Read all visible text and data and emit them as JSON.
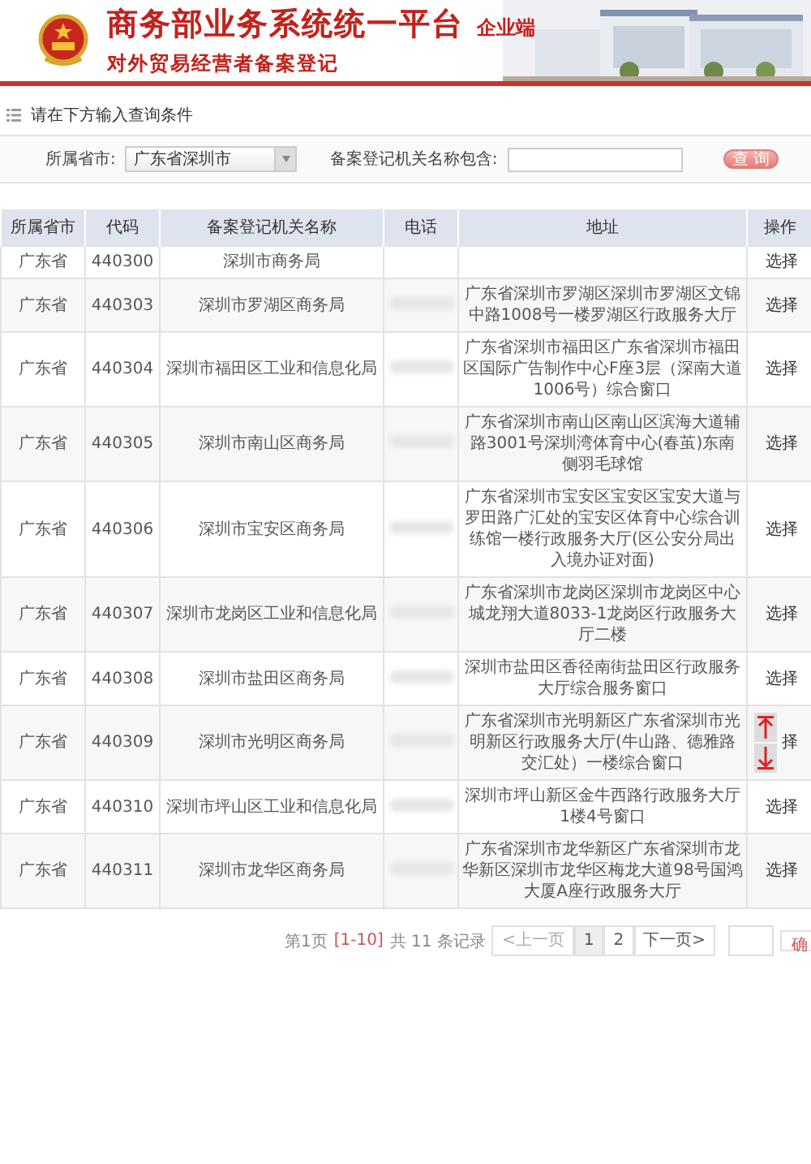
{
  "header": {
    "title": "商务部业务系统统一平台",
    "edition": "企业端",
    "subtitle": "对外贸易经营者备案登记"
  },
  "query": {
    "heading": "请在下方输入查询条件",
    "province_label": "所属省市:",
    "province_value": "广东省深圳市",
    "name_label": "备案登记机关名称包含:",
    "search_button": "查 询"
  },
  "table": {
    "columns": [
      "所属省市",
      "代码",
      "备案登记机关名称",
      "电话",
      "地址",
      "操作"
    ],
    "rows": [
      {
        "province": "广东省",
        "code": "440300",
        "name": "深圳市商务局",
        "phone_redacted": false,
        "address": "",
        "action": "选择",
        "scroll_buttons": false
      },
      {
        "province": "广东省",
        "code": "440303",
        "name": "深圳市罗湖区商务局",
        "phone_redacted": true,
        "address": "广东省深圳市罗湖区深圳市罗湖区文锦中路1008号一楼罗湖区行政服务大厅",
        "action": "选择",
        "scroll_buttons": false
      },
      {
        "province": "广东省",
        "code": "440304",
        "name": "深圳市福田区工业和信息化局",
        "phone_redacted": true,
        "address": "广东省深圳市福田区广东省深圳市福田区国际广告制作中心F座3层（深南大道1006号）综合窗口",
        "action": "选择",
        "scroll_buttons": false
      },
      {
        "province": "广东省",
        "code": "440305",
        "name": "深圳市南山区商务局",
        "phone_redacted": true,
        "address": "广东省深圳市南山区南山区滨海大道辅路3001号深圳湾体育中心(春茧)东南侧羽毛球馆",
        "action": "选择",
        "scroll_buttons": false
      },
      {
        "province": "广东省",
        "code": "440306",
        "name": "深圳市宝安区商务局",
        "phone_redacted": true,
        "address": "广东省深圳市宝安区宝安区宝安大道与罗田路广汇处的宝安区体育中心综合训练馆一楼行政服务大厅(区公安分局出入境办证对面)",
        "action": "选择",
        "scroll_buttons": false
      },
      {
        "province": "广东省",
        "code": "440307",
        "name": "深圳市龙岗区工业和信息化局",
        "phone_redacted": true,
        "address": "广东省深圳市龙岗区深圳市龙岗区中心城龙翔大道8033-1龙岗区行政服务大厅二楼",
        "action": "选择",
        "scroll_buttons": false
      },
      {
        "province": "广东省",
        "code": "440308",
        "name": "深圳市盐田区商务局",
        "phone_redacted": true,
        "address": "深圳市盐田区香径南街盐田区行政服务大厅综合服务窗口",
        "action": "选择",
        "scroll_buttons": false
      },
      {
        "province": "广东省",
        "code": "440309",
        "name": "深圳市光明区商务局",
        "phone_redacted": true,
        "address": "广东省深圳市光明新区广东省深圳市光明新区行政服务大厅(牛山路、德雅路交汇处）一楼综合窗口",
        "action": "择",
        "scroll_buttons": true
      },
      {
        "province": "广东省",
        "code": "440310",
        "name": "深圳市坪山区工业和信息化局",
        "phone_redacted": true,
        "address": "深圳市坪山新区金牛西路行政服务大厅1楼4号窗口",
        "action": "选择",
        "scroll_buttons": false
      },
      {
        "province": "广东省",
        "code": "440311",
        "name": "深圳市龙华区商务局",
        "phone_redacted": true,
        "address": "广东省深圳市龙华新区广东省深圳市龙华新区深圳市龙华区梅龙大道98号国鸿大厦A座行政服务大厅",
        "action": "选择",
        "scroll_buttons": false
      }
    ]
  },
  "pager": {
    "current": "第1页",
    "range": "[1-10]",
    "total": "共 11 条记录",
    "prev": "<上一页",
    "pages": [
      {
        "label": "1",
        "selected": true
      },
      {
        "label": "2",
        "selected": false
      }
    ],
    "next": "下一页>",
    "go": "确"
  }
}
